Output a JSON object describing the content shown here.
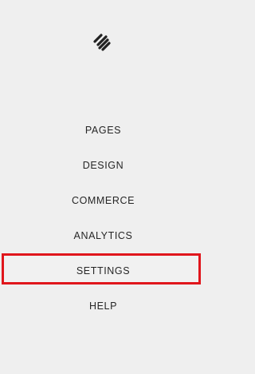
{
  "sidebar": {
    "logo_icon": "squarespace-logo-icon",
    "items": [
      {
        "label": "PAGES"
      },
      {
        "label": "DESIGN"
      },
      {
        "label": "COMMERCE"
      },
      {
        "label": "ANALYTICS"
      },
      {
        "label": "SETTINGS",
        "highlighted": true
      },
      {
        "label": "HELP"
      }
    ]
  },
  "colors": {
    "background": "#efefef",
    "text": "#262626",
    "highlight_border": "#e0161c"
  }
}
